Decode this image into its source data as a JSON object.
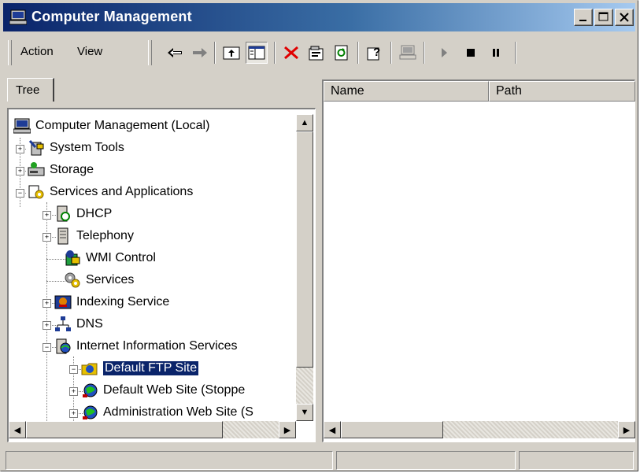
{
  "window": {
    "title": "Computer Management",
    "icon": "computer-management-icon"
  },
  "menu": {
    "action": "Action",
    "view": "View"
  },
  "toolbar": {
    "icons": [
      "back-arrow-icon",
      "forward-arrow-icon",
      "up-folder-icon",
      "show-hide-tree-icon",
      "delete-icon",
      "properties-icon",
      "refresh-icon",
      "help-icon",
      "connect-computer-icon",
      "play-icon",
      "stop-icon",
      "pause-icon"
    ]
  },
  "tree_tab": {
    "label": "Tree"
  },
  "tree": {
    "items": [
      {
        "label": "Computer Management (Local)",
        "icon": "computer-icon"
      },
      {
        "label": "System Tools",
        "icon": "system-tools-icon"
      },
      {
        "label": "Storage",
        "icon": "storage-icon"
      },
      {
        "label": "Services and Applications",
        "icon": "services-apps-icon"
      },
      {
        "label": "DHCP",
        "icon": "dhcp-icon"
      },
      {
        "label": "Telephony",
        "icon": "telephony-icon"
      },
      {
        "label": "WMI Control",
        "icon": "wmi-icon"
      },
      {
        "label": "Services",
        "icon": "services-icon"
      },
      {
        "label": "Indexing Service",
        "icon": "indexing-icon"
      },
      {
        "label": "DNS",
        "icon": "dns-icon"
      },
      {
        "label": "Internet Information Services",
        "icon": "iis-icon"
      },
      {
        "label": "Default FTP Site",
        "icon": "ftp-site-icon"
      },
      {
        "label": "Default Web Site (Stoppe",
        "icon": "web-site-icon"
      },
      {
        "label": "Administration Web Site (S",
        "icon": "web-site-icon"
      }
    ]
  },
  "list": {
    "columns": [
      "Name",
      "Path"
    ]
  },
  "colors": {
    "title_start": "#0a246a",
    "title_end": "#a6caf0",
    "selection": "#0a246a",
    "face": "#d4d0c8"
  }
}
